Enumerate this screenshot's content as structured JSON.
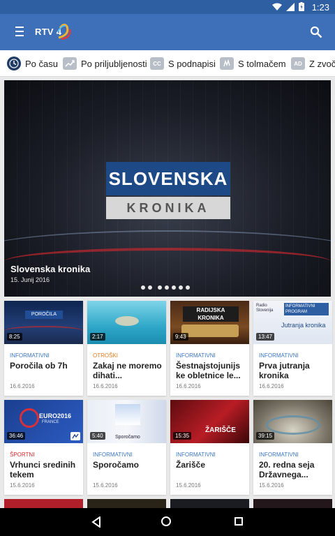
{
  "status": {
    "time": "1:23"
  },
  "app": {
    "logo_text": "RTV 4"
  },
  "filters": [
    {
      "label": "Po času",
      "icon": "clock-icon"
    },
    {
      "label": "Po priljubljenosti",
      "icon": "trending-icon"
    },
    {
      "label": "S podnapisi",
      "icon": "cc-icon",
      "badge": "CC"
    },
    {
      "label": "S tolmačem",
      "icon": "sign-language-icon"
    },
    {
      "label": "Z zvočn",
      "icon": "audio-description-icon",
      "badge": "AD"
    }
  ],
  "hero": {
    "badge_top": "SLOVENSKA",
    "badge_bottom": "KRONIKA",
    "title": "Slovenska kronika",
    "date": "15. Junij 2016"
  },
  "cards": [
    {
      "duration": "8:25",
      "category": "INFORMATIVNI",
      "title": "Poročila ob 7h",
      "date": "16.6.2016",
      "thumb_label": "POROČILA"
    },
    {
      "duration": "2:17",
      "category": "OTROŠKI",
      "title": "Zakaj ne moremo dihati...",
      "date": "16.6.2016"
    },
    {
      "duration": "9:43",
      "category": "INFORMATIVNI",
      "title": "Šestnajstojunijs ke obletnice le...",
      "date": "16.6.2016",
      "thumb_label": "RADIJSKA KRONIKA"
    },
    {
      "duration": "13:47",
      "category": "INFORMATIVNI",
      "title": "Prva jutranja kronika",
      "date": "16.6.2016",
      "thumb_label": "Jutranja kronika",
      "thumb_top_left": "Radio Slovenija",
      "thumb_top_right": "INFORMATIVNI PROGRAM"
    },
    {
      "duration": "36:46",
      "category": "ŠPORTNI",
      "title": "Vrhunci sredinih tekem",
      "date": "15.6.2016",
      "thumb_label": "EURO2016",
      "thumb_sub": "FRANCE"
    },
    {
      "duration": "5:40",
      "category": "INFORMATIVNI",
      "title": "Sporočamo",
      "date": "15.6.2016",
      "thumb_label": "Sporočamo"
    },
    {
      "duration": "15:35",
      "category": "INFORMATIVNI",
      "title": "Žarišče",
      "date": "15.6.2016",
      "thumb_label": "ŽARIŠČE"
    },
    {
      "duration": "39:15",
      "category": "INFORMATIVNI",
      "title": "20. redna seja Državnega...",
      "date": "15.6.2016"
    }
  ]
}
